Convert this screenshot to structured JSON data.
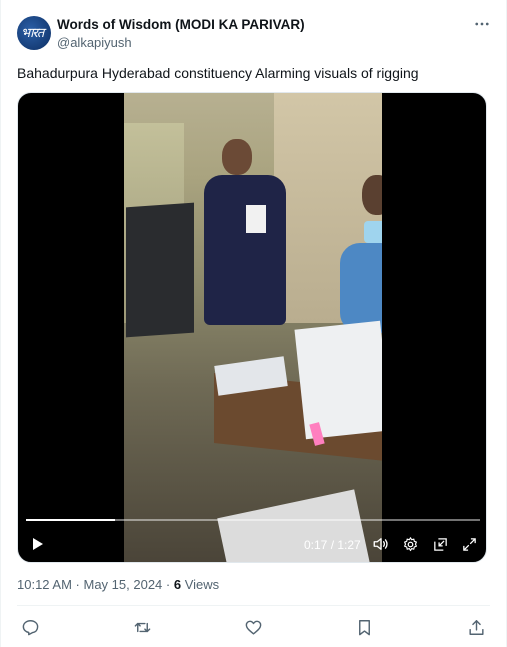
{
  "author": {
    "avatar_text": "भारत",
    "name": "Words of Wisdom (MODI KA PARIVAR)",
    "handle": "@alkapiyush"
  },
  "tweet": {
    "text": "Bahadurpura Hyderabad constituency Alarming visuals of rigging"
  },
  "video": {
    "current_time": "0:17",
    "separator": " / ",
    "duration": "1:27",
    "progress_fraction": 0.195
  },
  "meta": {
    "time": "10:12 AM",
    "dot": " · ",
    "date": "May 15, 2024",
    "views_count": "6",
    "views_label": " Views"
  },
  "icons": {
    "more": "more-horizontal-icon",
    "play": "play-icon",
    "volume": "volume-icon",
    "settings": "settings-gear-icon",
    "pip": "picture-in-picture-icon",
    "fullscreen": "fullscreen-icon",
    "reply": "reply-icon",
    "retweet": "retweet-icon",
    "like": "heart-icon",
    "bookmark": "bookmark-icon",
    "share": "share-icon"
  },
  "colors": {
    "text_primary": "#0f1419",
    "text_secondary": "#536471",
    "divider": "#eff3f4"
  }
}
